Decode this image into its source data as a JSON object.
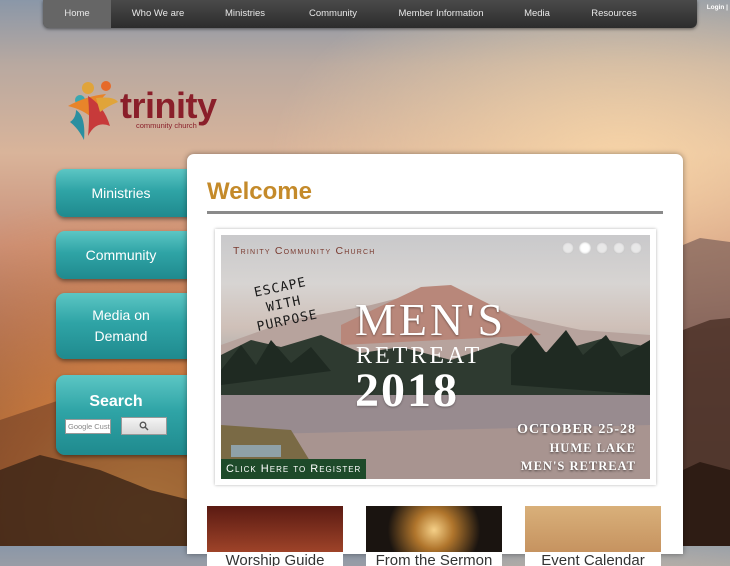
{
  "nav": {
    "items": [
      "Home",
      "Who We are",
      "Ministries",
      "Community",
      "Member Information",
      "Media",
      "Resources"
    ],
    "login": "Login |"
  },
  "logo": {
    "name": "trinity",
    "sub": "community church"
  },
  "sidebar": {
    "ministries": "Ministries",
    "community": "Community",
    "media_line1": "Media on",
    "media_line2": "Demand",
    "search_title": "Search",
    "search_placeholder": "Google Custom Search"
  },
  "main": {
    "title": "Welcome",
    "slide": {
      "org": "Trinity Community Church",
      "tagline": [
        "ESCAPE",
        "WITH",
        "PURPOSE"
      ],
      "heading": "MEN'S",
      "sub": "RETREAT",
      "year": "2018",
      "date": "OCTOBER 25-28",
      "location": "HUME LAKE",
      "event": "MEN'S RETREAT",
      "cta": "Click Here to Register",
      "active_index": 1,
      "count": 5
    },
    "cards": [
      "Worship Guide",
      "From the Sermon",
      "Event Calendar"
    ]
  },
  "colors": {
    "accent": "#c48a2a",
    "teal": "#2fa4a6",
    "brand": "#8a1f2a"
  }
}
